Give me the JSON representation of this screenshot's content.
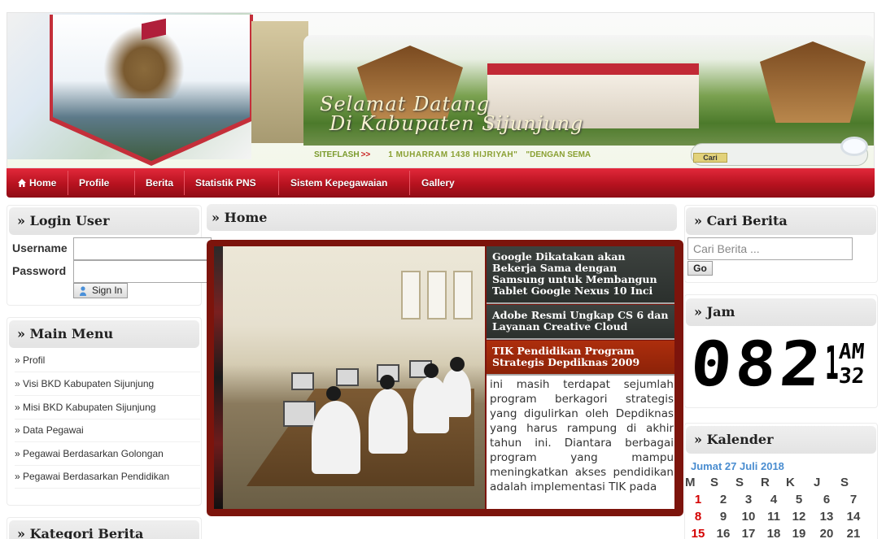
{
  "header": {
    "welcome_line1": "Selamat Datang",
    "welcome_line2": "Di Kabupaten Sijunjung",
    "siteflash_label": "SITEFLASH",
    "siteflash_arrow": ">>",
    "siteflash_msg1": "1 MUHARRAM 1438 HIJRIYAH\"",
    "siteflash_msg2": "\"DENGAN SEMA",
    "search_button": "Cari"
  },
  "nav": {
    "items": [
      "Home",
      "Profile",
      "Berita",
      "Statistik PNS",
      "Sistem Kepegawaian",
      "Gallery"
    ]
  },
  "login": {
    "title": "» Login User",
    "username_label": "Username",
    "password_label": "Password",
    "signin_label": "Sign In"
  },
  "main_menu": {
    "title": "» Main Menu",
    "items": [
      "» Profil",
      "» Visi BKD Kabupaten Sijunjung",
      "» Misi BKD Kabupaten Sijunjung",
      "» Data Pegawai",
      "» Pegawai Berdasarkan Golongan",
      "» Pegawai Berdasarkan Pendidikan"
    ]
  },
  "kategori": {
    "title": "» Kategori Berita"
  },
  "content": {
    "title": "» Home",
    "news": [
      "Google Dikatakan akan Bekerja Sama dengan Samsung untuk Membangun Tablet Google Nexus 10 Inci",
      "Adobe Resmi Ungkap CS 6 dan Layanan Creative Cloud",
      "TIK Pendidikan Program Strategis Depdiknas 2009"
    ],
    "active_news_index": 2,
    "excerpt": "ini masih terdapat sejumlah program berkagori strategis yang digulirkan oleh Depdiknas yang harus rampung di akhir tahun ini. Diantara berbagai program yang mampu meningkatkan akses pendidikan adalah implementasi TIK pada"
  },
  "cari_berita": {
    "title": "» Cari Berita",
    "placeholder": "Cari Berita ...",
    "go_label": "Go"
  },
  "jam": {
    "title": "» Jam",
    "hour_min": "082",
    "hour_prefix": "1",
    "ampm": "AM",
    "seconds": "32"
  },
  "kalender": {
    "title": "» Kalender",
    "date_text": "Jumat 27 Juli 2018",
    "weekdays": [
      "M",
      "S",
      "S",
      "R",
      "K",
      "J",
      "S"
    ],
    "rows": [
      [
        "1",
        "2",
        "3",
        "4",
        "5",
        "6",
        "7"
      ],
      [
        "8",
        "9",
        "10",
        "11",
        "12",
        "13",
        "14"
      ],
      [
        "15",
        "16",
        "17",
        "18",
        "19",
        "20",
        "21"
      ]
    ]
  },
  "colors": {
    "nav_red": "#b6121f",
    "slider_frame": "#7c140c",
    "active_news": "#ad2e0d",
    "calendar_date": "#4a8dd0",
    "sunday": "#d40000"
  }
}
